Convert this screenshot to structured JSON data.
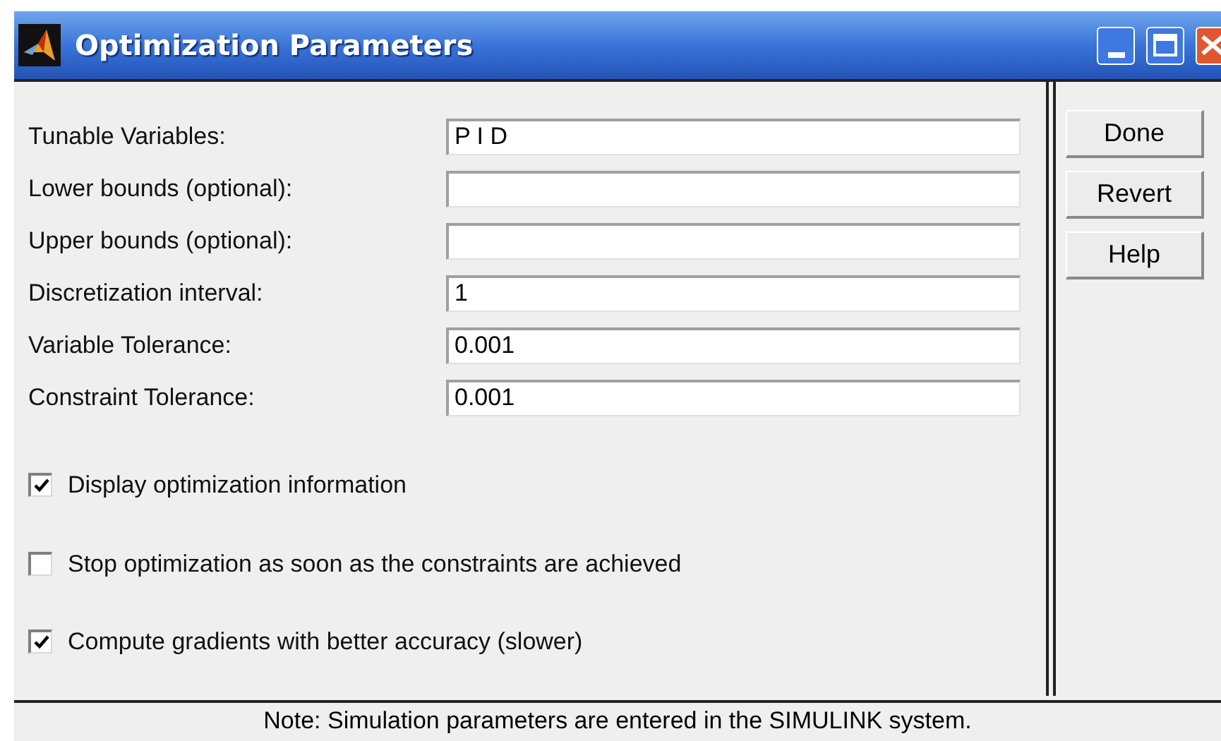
{
  "window": {
    "title": "Optimization Parameters"
  },
  "fields": [
    {
      "label": "Tunable Variables:",
      "value": "P I D"
    },
    {
      "label": "Lower bounds (optional):"
    },
    {
      "label": "Upper bounds (optional):"
    },
    {
      "label": "Discretization interval:",
      "value": "1"
    },
    {
      "label": "Variable Tolerance:",
      "value": "0.001"
    },
    {
      "label": "Constraint Tolerance:",
      "value": "0.001"
    }
  ],
  "options": [
    {
      "label": "Display optimization information",
      "checked": true
    },
    {
      "label": "Stop optimization as soon as the constraints are achieved",
      "checked": false
    },
    {
      "label": "Compute gradients with better accuracy (slower)",
      "checked": true
    }
  ],
  "buttons": [
    "Done",
    "Revert",
    "Help"
  ],
  "note": "Note: Simulation parameters are entered in the SIMULINK system."
}
